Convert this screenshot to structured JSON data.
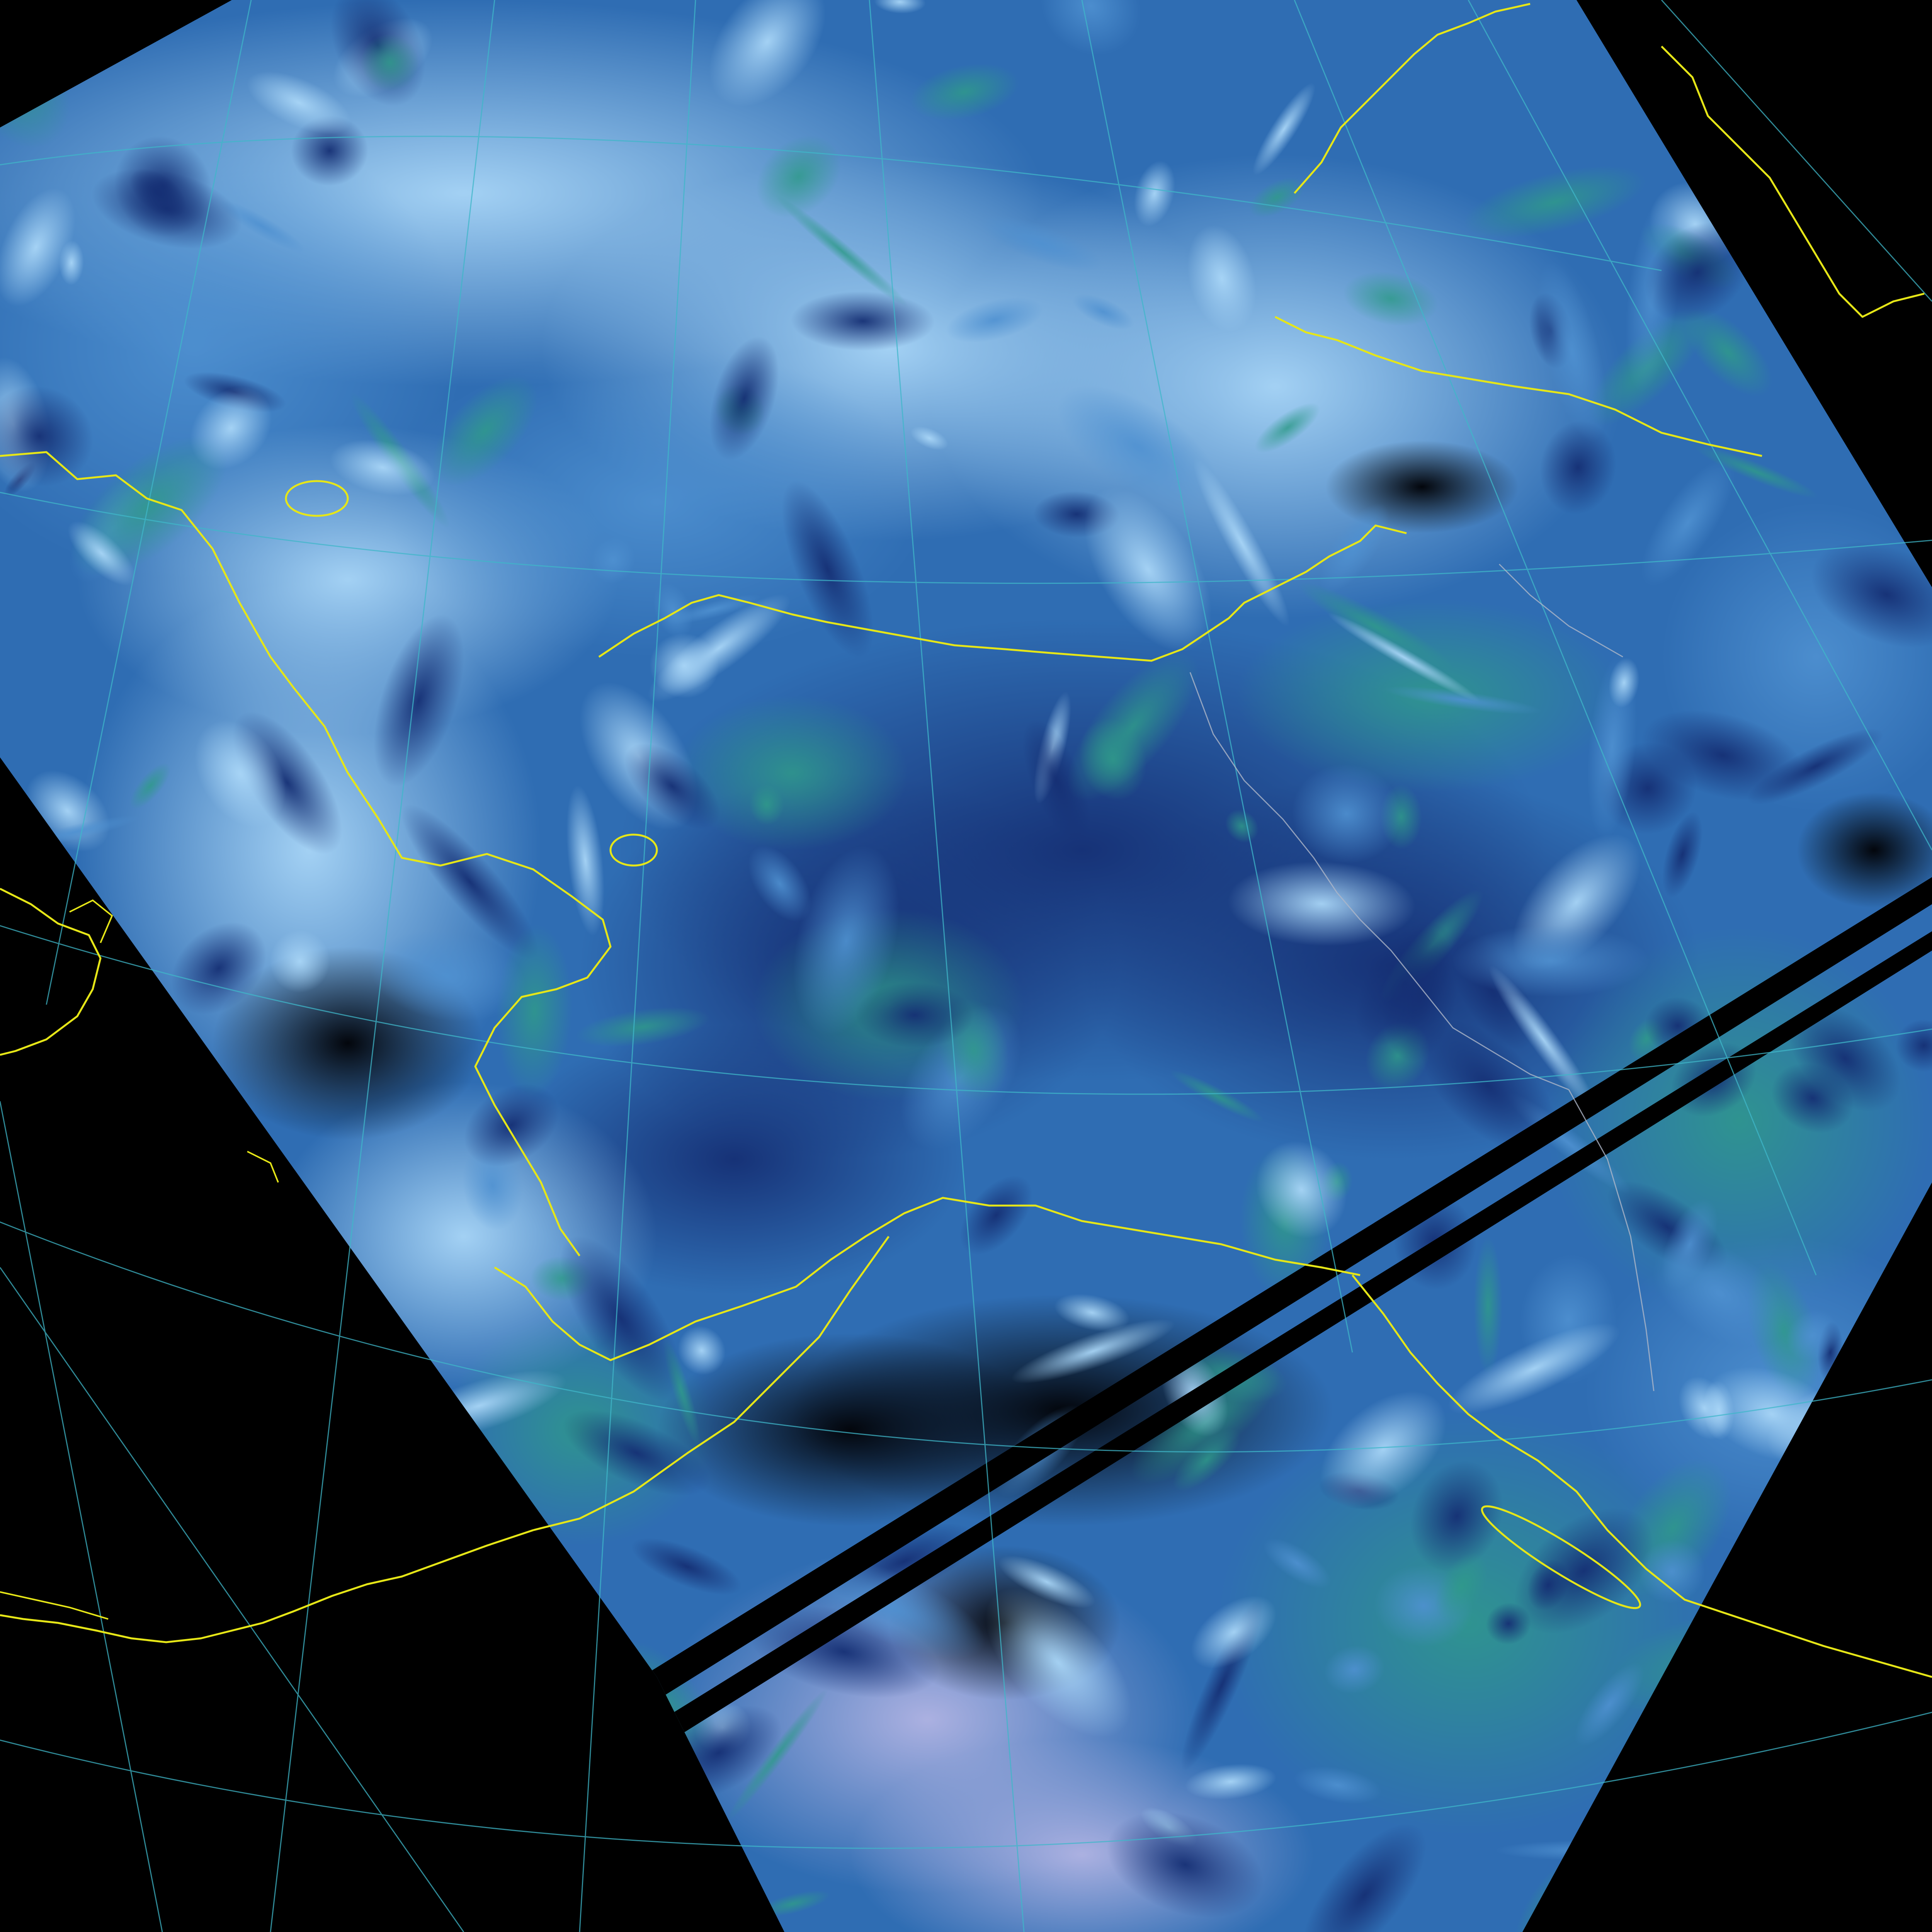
{
  "map": {
    "projection": "polar-stereographic",
    "imagery": "satellite-composite-swath",
    "colors": {
      "background": "#000000",
      "coastline": "#e6e617",
      "borders": "#9aa6b8",
      "graticule": "#3fb7c9",
      "cloud_light": "#8fc4ec",
      "cloud_mid": "#3f7fbf",
      "cloud_deep": "#1b3f86",
      "ocean_green": "#2f8f86",
      "night_dark": "#050910"
    },
    "layers": [
      "satellite-swath",
      "graticule",
      "coastlines",
      "political-borders"
    ],
    "data_gaps": 2
  }
}
